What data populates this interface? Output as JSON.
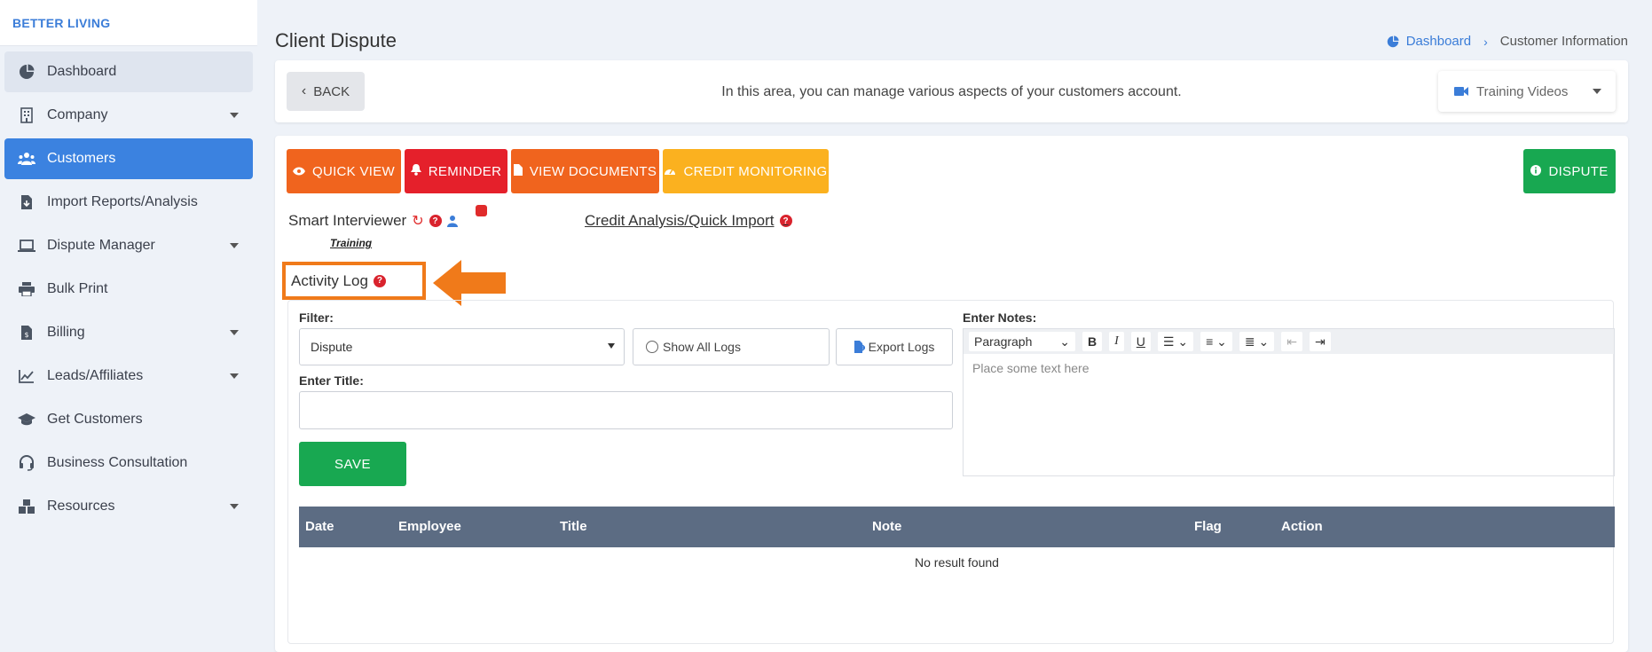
{
  "brand": "BETTER LIVING",
  "sidebar": {
    "items": [
      {
        "label": "Dashboard",
        "icon": "dashboard-icon"
      },
      {
        "label": "Company",
        "icon": "building-icon"
      },
      {
        "label": "Customers",
        "icon": "users-icon"
      },
      {
        "label": "Import Reports/Analysis",
        "icon": "file-import-icon"
      },
      {
        "label": "Dispute Manager",
        "icon": "laptop-icon"
      },
      {
        "label": "Bulk Print",
        "icon": "print-icon"
      },
      {
        "label": "Billing",
        "icon": "invoice-icon"
      },
      {
        "label": "Leads/Affiliates",
        "icon": "chart-line-icon"
      },
      {
        "label": "Get Customers",
        "icon": "graduation-cap-icon"
      },
      {
        "label": "Business Consultation",
        "icon": "headset-icon"
      },
      {
        "label": "Resources",
        "icon": "boxes-icon"
      }
    ]
  },
  "header": {
    "title": "Client Dispute",
    "breadcrumb": {
      "home": "Dashboard",
      "current": "Customer Information"
    }
  },
  "topbar": {
    "back": "BACK",
    "info": "In this area, you can manage various aspects of your customers account.",
    "training_videos": "Training Videos"
  },
  "actions": {
    "quick_view": "QUICK VIEW",
    "reminder": "REMINDER",
    "view_documents": "VIEW DOCUMENTS",
    "credit_monitoring": "CREDIT MONITORING",
    "dispute": "DISPUTE"
  },
  "colors": {
    "quick_view": "#f0641e",
    "reminder": "#e5202b",
    "view_documents": "#f0641e",
    "credit_monitoring": "#fbb11f",
    "dispute": "#18a851",
    "highlight": "#f07a1a",
    "active_nav": "#3b82e0"
  },
  "links": {
    "smart_interviewer": "Smart Interviewer",
    "training": "Training",
    "credit_analysis": "Credit Analysis/Quick Import"
  },
  "activity_log": {
    "title": "Activity Log",
    "filter_label": "Filter:",
    "filter_value": "Dispute",
    "show_all": "Show All Logs",
    "export": "Export Logs",
    "title_label": "Enter Title:",
    "notes_label": "Enter Notes:",
    "paragraph": "Paragraph",
    "editor_placeholder": "Place some text here",
    "save": "SAVE",
    "columns": [
      "Date",
      "Employee",
      "Title",
      "Note",
      "Flag",
      "Action"
    ],
    "empty": "No result found"
  }
}
